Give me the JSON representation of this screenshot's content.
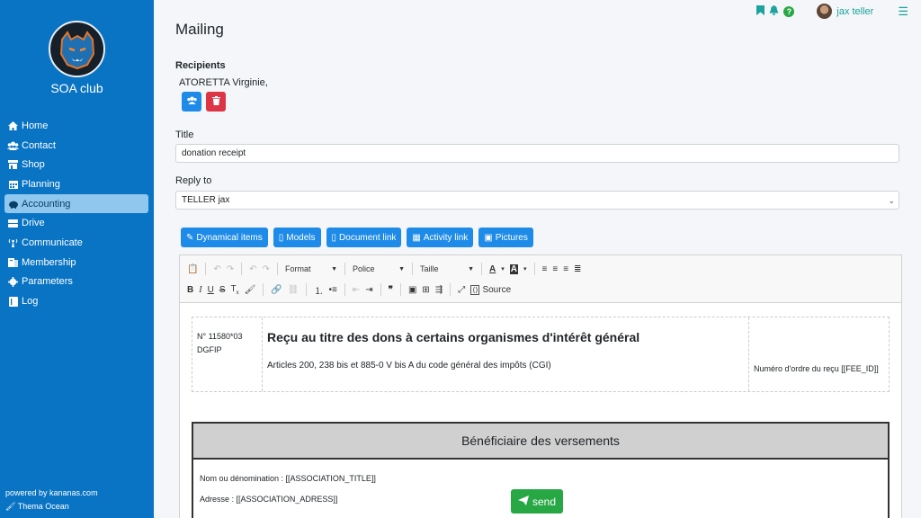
{
  "sidebar": {
    "club_name": "SOA club",
    "items": [
      {
        "label": "Home",
        "icon": "home-icon"
      },
      {
        "label": "Contact",
        "icon": "users-icon"
      },
      {
        "label": "Shop",
        "icon": "shop-icon"
      },
      {
        "label": "Planning",
        "icon": "calendar-icon"
      },
      {
        "label": "Accounting",
        "icon": "piggy-bank-icon"
      },
      {
        "label": "Drive",
        "icon": "drive-icon"
      },
      {
        "label": "Communicate",
        "icon": "broadcast-icon"
      },
      {
        "label": "Membership",
        "icon": "membership-icon"
      },
      {
        "label": "Parameters",
        "icon": "gear-icon"
      },
      {
        "label": "Log",
        "icon": "log-icon"
      }
    ],
    "active": "Accounting",
    "powered": "powered by kananas.com",
    "theme": "Thema Ocean"
  },
  "header": {
    "user": "jax teller"
  },
  "main": {
    "title": "Mailing",
    "recipients_label": "Recipients",
    "recipient": "ATORETTA Virginie,",
    "title_label": "Title",
    "title_value": "donation receipt",
    "reply_label": "Reply to",
    "reply_value": "TELLER jax"
  },
  "buttons": {
    "dynamical": "Dynamical items",
    "models": "Models",
    "document_link": "Document link",
    "activity_link": "Activity link",
    "pictures": "Pictures",
    "send": "send"
  },
  "editor": {
    "format": "Format",
    "police": "Police",
    "taille": "Taille",
    "source": "Source",
    "doc": {
      "num": "N° 11580*03",
      "dgfip": "DGFIP",
      "heading": "Reçu au titre des dons à certains organismes d'intérêt général",
      "articles": "Articles 200, 238 bis et 885-0 V bis A du code général des impôts (CGI)",
      "order": "Numéro d'ordre du reçu [[FEE_ID]]",
      "beneficiary": "Bénéficiaire des versements",
      "name_line": "Nom ou dénomination : [[ASSOCIATION_TITLE]]",
      "address_line": "Adresse : [[ASSOCIATION_ADRESS]]"
    }
  },
  "colors": {
    "sidebar": "#0a74c4",
    "accent": "#1f8be8",
    "teal": "#1ba39c",
    "danger": "#dc3545",
    "success": "#28a745"
  }
}
